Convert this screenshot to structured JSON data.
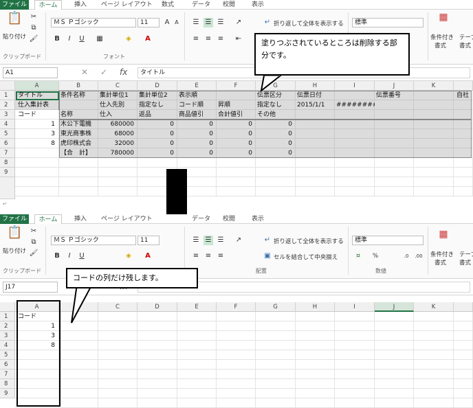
{
  "ribbon": {
    "tabs": [
      "ファイル",
      "ホーム",
      "挿入",
      "ページ レイアウト",
      "数式",
      "データ",
      "校閲",
      "表示"
    ],
    "font_name": "ＭＳ Ｐゴシック",
    "font_size": "11",
    "wrap_text": "折り返して全体を表示する",
    "merge_center": "セルを結合して中央揃え",
    "number_format": "標準",
    "paste": "貼り付け",
    "cond_format_1": "条件付き",
    "cond_format_2": "書式",
    "table_1": "テーブ",
    "table_2": "書式",
    "group_clipboard": "クリップボード",
    "group_font": "フォント",
    "group_alignment": "配置",
    "group_number": "数値",
    "percent": "%"
  },
  "top_sheet": {
    "name_box": "A1",
    "formula": "タイトル",
    "columns": [
      "A",
      "B",
      "C",
      "D",
      "E",
      "F",
      "G",
      "H",
      "I",
      "J",
      "K"
    ],
    "rows": [
      "1",
      "2",
      "3",
      "4",
      "5",
      "6",
      "7",
      "8",
      "9"
    ],
    "r1": {
      "a": "タイトル",
      "b": "条件名称",
      "c": "集計単位1",
      "d": "集計単位2",
      "e": "表示順",
      "g": "伝票区分",
      "h": "伝票日付",
      "j": "伝票番号",
      "l": "自社"
    },
    "r2": {
      "a": "仕入集計表",
      "c": "仕入先別",
      "d": "指定なし",
      "e": "コード順",
      "f": "昇順",
      "g": "指定なし",
      "h": "2015/1/1",
      "i": "########"
    },
    "r3": {
      "a": "コード",
      "b": "名称",
      "c": "仕入",
      "d": "返品",
      "e": "商品値引",
      "f": "合計値引",
      "g": "その他"
    },
    "data": [
      {
        "code": "1",
        "name": "木公下電機",
        "shiire": "680000",
        "d": "0",
        "e": "0",
        "f": "0",
        "g": "0"
      },
      {
        "code": "3",
        "name": "東光商事株",
        "shiire": "68000",
        "d": "0",
        "e": "0",
        "f": "0",
        "g": "0"
      },
      {
        "code": "8",
        "name": "虎印株式会",
        "shiire": "32000",
        "d": "0",
        "e": "0",
        "f": "0",
        "g": "0"
      },
      {
        "code": "",
        "name": "【合　計】",
        "shiire": "780000",
        "d": "0",
        "e": "0",
        "f": "0",
        "g": "0"
      }
    ],
    "callout": "塗りつぶされているところは削除する部分です。"
  },
  "bottom_sheet": {
    "name_box": "J17",
    "columns": [
      "A",
      "B",
      "C",
      "D",
      "E",
      "F",
      "G",
      "H",
      "I",
      "J",
      "K"
    ],
    "rows": [
      "1",
      "2",
      "3",
      "4",
      "5",
      "6",
      "7",
      "8",
      "9"
    ],
    "header": "コード",
    "codes": [
      "1",
      "3",
      "8"
    ],
    "callout": "コードの列だけ残します。"
  },
  "colors": {
    "excel_green": "#217346",
    "shade": "#888888"
  }
}
